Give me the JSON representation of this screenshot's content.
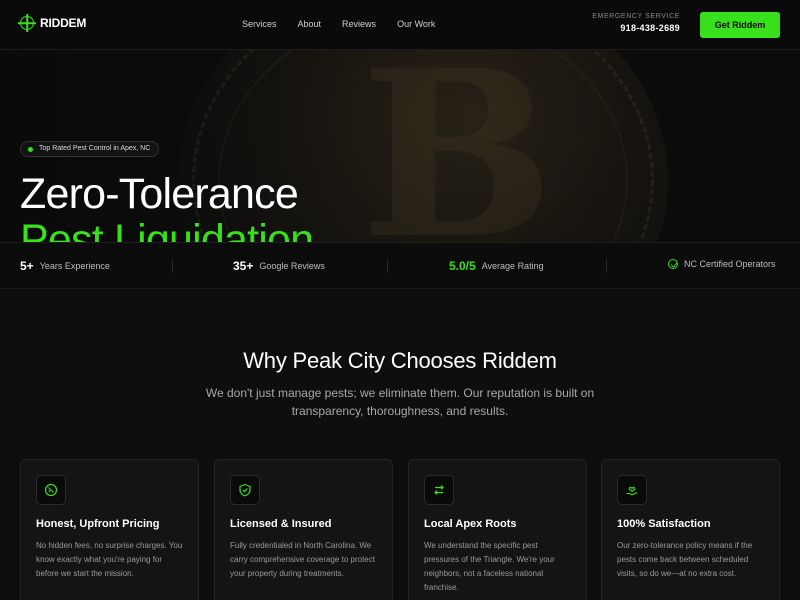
{
  "brand": {
    "name": "RIDDEM",
    "accent": "#39e01c"
  },
  "nav": {
    "links": [
      "Services",
      "About",
      "Reviews",
      "Our Work"
    ],
    "emergency_label": "EMERGENCY SERVICE",
    "phone": "918-438-2689",
    "cta_label": "Get Riddem"
  },
  "hero": {
    "badge": "Top Rated Pest Control in Apex, NC",
    "title_line1": "Zero-Tolerance",
    "title_line2": "Pest Liquidation"
  },
  "stats": [
    {
      "value": "5+",
      "label": "Years Experience"
    },
    {
      "value": "35+",
      "label": "Google Reviews"
    },
    {
      "value": "5.0/5",
      "label": "Average Rating"
    },
    {
      "value": "",
      "label": "NC Certified Operators"
    }
  ],
  "why": {
    "title": "Why Peak City Chooses Riddem",
    "subtitle": "We don't just manage pests; we eliminate them. Our reputation is built on transparency, thoroughness, and results.",
    "cards": [
      {
        "icon": "price-tag-icon",
        "title": "Honest, Upfront Pricing",
        "text": "No hidden fees, no surprise charges. You know exactly what you're paying for before we start the mission."
      },
      {
        "icon": "shield-check-icon",
        "title": "Licensed & Insured",
        "text": "Fully credentialed in North Carolina. We carry comprehensive coverage to protect your property during treatments."
      },
      {
        "icon": "arrows-exchange-icon",
        "title": "Local Apex Roots",
        "text": "We understand the specific pest pressures of the Triangle. We're your neighbors, not a faceless national franchise."
      },
      {
        "icon": "hand-heart-icon",
        "title": "100% Satisfaction",
        "text": "Our zero-tolerance policy means if the pests come back between scheduled visits, so do we—at no extra cost."
      }
    ]
  }
}
